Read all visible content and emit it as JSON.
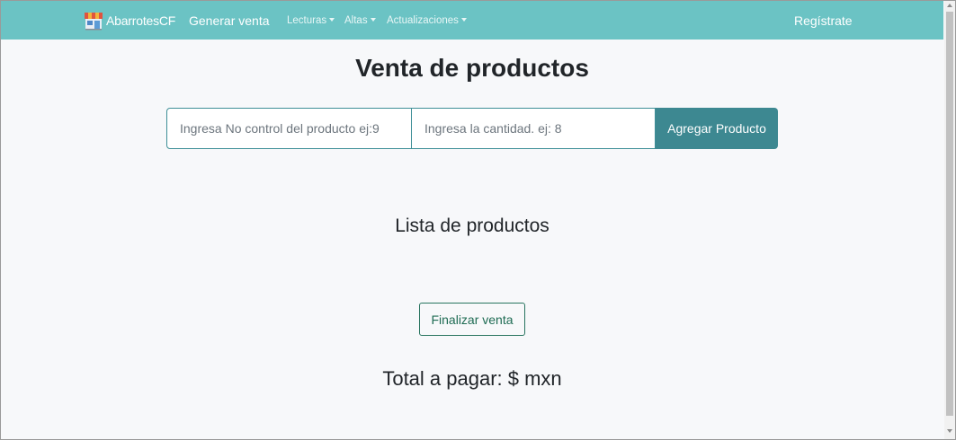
{
  "navbar": {
    "brand": "AbarrotesCF",
    "generar_venta": "Generar venta",
    "dropdowns": [
      "Lecturas",
      "Altas",
      "Actualizaciones"
    ],
    "register": "Regístrate",
    "color": "#6bc3c4"
  },
  "main": {
    "title": "Venta de productos",
    "code_placeholder": "Ingresa No control del producto ej:9",
    "quantity_placeholder": "Ingresa la cantidad. ej: 8",
    "add_button": "Agregar Producto",
    "list_title": "Lista de productos",
    "finish_button": "Finalizar venta",
    "total": "Total a pagar: $ mxn"
  },
  "colors": {
    "accent_button": "#3d8891",
    "finish_button_border": "#28745f"
  },
  "icons": {
    "brand": "store-icon"
  }
}
